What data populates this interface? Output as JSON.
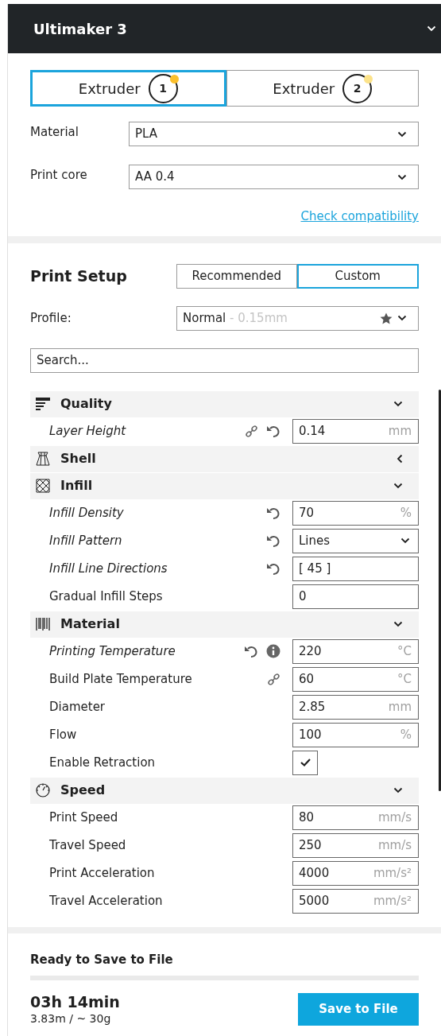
{
  "machine": {
    "name": "Ultimaker 3"
  },
  "extruders": [
    {
      "label": "Extruder",
      "number": "1",
      "selected": true,
      "color": "#fbc02d"
    },
    {
      "label": "Extruder",
      "number": "2",
      "selected": false,
      "color": "#fce38a"
    }
  ],
  "material": {
    "label": "Material",
    "value": "PLA"
  },
  "print_core": {
    "label": "Print core",
    "value": "AA 0.4"
  },
  "compatibility_link": "Check compatibility",
  "print_setup": {
    "title": "Print Setup",
    "modes": [
      {
        "label": "Recommended",
        "selected": false
      },
      {
        "label": "Custom",
        "selected": true
      }
    ],
    "profile": {
      "label": "Profile:",
      "value": "Normal",
      "detail": "- 0.15mm"
    },
    "search": {
      "placeholder": "Search..."
    }
  },
  "categories": [
    {
      "name": "Quality",
      "kind": "quality",
      "expanded": true,
      "settings": [
        {
          "label": "Layer Height",
          "modified": true,
          "linked": true,
          "resettable": true,
          "info": false,
          "kind": "number",
          "value": "0.14",
          "unit": "mm"
        }
      ]
    },
    {
      "name": "Shell",
      "kind": "shell",
      "expanded": false
    },
    {
      "name": "Infill",
      "kind": "infill",
      "expanded": true,
      "settings": [
        {
          "label": "Infill Density",
          "modified": true,
          "linked": false,
          "resettable": true,
          "info": false,
          "kind": "number",
          "value": "70",
          "unit": "%"
        },
        {
          "label": "Infill Pattern",
          "modified": true,
          "linked": false,
          "resettable": true,
          "info": false,
          "kind": "dropdown",
          "value": "Lines"
        },
        {
          "label": "Infill Line Directions",
          "modified": true,
          "linked": false,
          "resettable": true,
          "info": false,
          "kind": "number",
          "value": "[ 45 ]"
        },
        {
          "label": "Gradual Infill Steps",
          "modified": false,
          "linked": false,
          "resettable": false,
          "info": false,
          "kind": "number",
          "value": "0"
        }
      ]
    },
    {
      "name": "Material",
      "kind": "material",
      "expanded": true,
      "settings": [
        {
          "label": "Printing Temperature",
          "modified": true,
          "linked": false,
          "resettable": true,
          "info": true,
          "kind": "number",
          "value": "220",
          "unit": "°C"
        },
        {
          "label": "Build Plate Temperature",
          "modified": false,
          "linked": true,
          "resettable": false,
          "info": false,
          "kind": "number",
          "value": "60",
          "unit": "°C"
        },
        {
          "label": "Diameter",
          "modified": false,
          "linked": false,
          "resettable": false,
          "info": false,
          "kind": "number",
          "value": "2.85",
          "unit": "mm"
        },
        {
          "label": "Flow",
          "modified": false,
          "linked": false,
          "resettable": false,
          "info": false,
          "kind": "number",
          "value": "100",
          "unit": "%"
        },
        {
          "label": "Enable Retraction",
          "modified": false,
          "linked": false,
          "resettable": false,
          "info": false,
          "kind": "checkbox",
          "checked": true
        }
      ]
    },
    {
      "name": "Speed",
      "kind": "speed",
      "expanded": true,
      "settings": [
        {
          "label": "Print Speed",
          "modified": false,
          "linked": false,
          "resettable": false,
          "info": false,
          "kind": "number",
          "value": "80",
          "unit": "mm/s"
        },
        {
          "label": "Travel Speed",
          "modified": false,
          "linked": false,
          "resettable": false,
          "info": false,
          "kind": "number",
          "value": "250",
          "unit": "mm/s"
        },
        {
          "label": "Print Acceleration",
          "modified": false,
          "linked": false,
          "resettable": false,
          "info": false,
          "kind": "number",
          "value": "4000",
          "unit": "mm/s²"
        },
        {
          "label": "Travel Acceleration",
          "modified": false,
          "linked": false,
          "resettable": false,
          "info": false,
          "kind": "number",
          "value": "5000",
          "unit": "mm/s²"
        }
      ]
    }
  ],
  "footer": {
    "status": "Ready to Save to File",
    "time": "03h 14min",
    "estimate": "3.83m / ~ 30g",
    "button": "Save to File"
  }
}
